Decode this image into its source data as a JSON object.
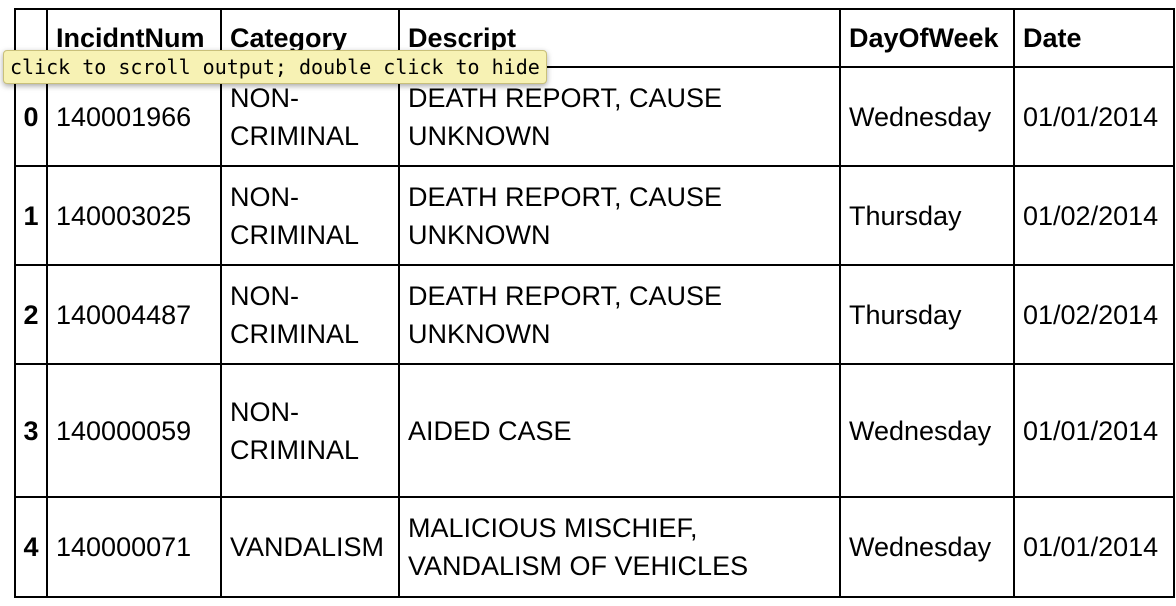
{
  "tooltip": {
    "text": "click to scroll output; double click to hide"
  },
  "table": {
    "columns": [
      "IncidntNum",
      "Category",
      "Descript",
      "DayOfWeek",
      "Date"
    ],
    "rows": [
      {
        "index": "0",
        "cells": [
          "140001966",
          "NON-CRIMINAL",
          "DEATH REPORT, CAUSE UNKNOWN",
          "Wednesday",
          "01/01/2014"
        ]
      },
      {
        "index": "1",
        "cells": [
          "140003025",
          "NON-CRIMINAL",
          "DEATH REPORT, CAUSE UNKNOWN",
          "Thursday",
          "01/02/2014"
        ]
      },
      {
        "index": "2",
        "cells": [
          "140004487",
          "NON-CRIMINAL",
          "DEATH REPORT, CAUSE UNKNOWN",
          "Thursday",
          "01/02/2014"
        ]
      },
      {
        "index": "3",
        "cells": [
          "140000059",
          "NON-CRIMINAL",
          "AIDED CASE",
          "Wednesday",
          "01/01/2014"
        ]
      },
      {
        "index": "4",
        "cells": [
          "140000071",
          "VANDALISM",
          "MALICIOUS MISCHIEF, VANDALISM OF VEHICLES",
          "Wednesday",
          "01/01/2014"
        ]
      }
    ]
  }
}
